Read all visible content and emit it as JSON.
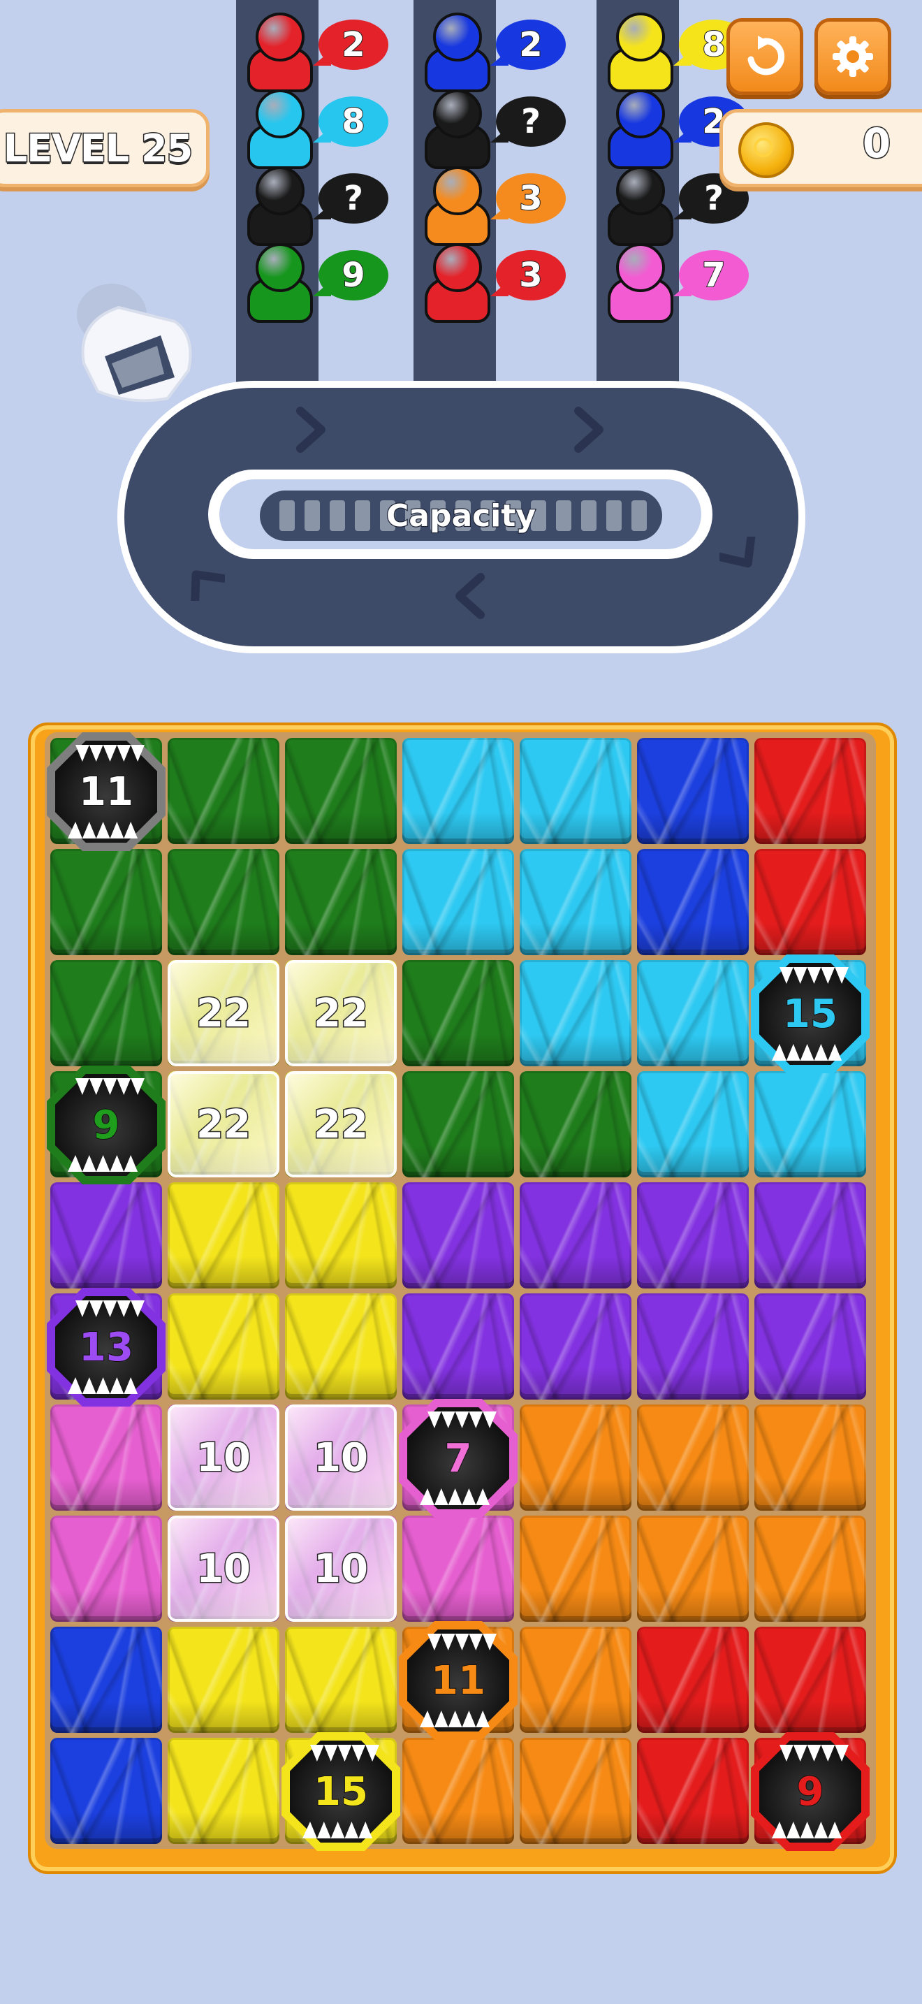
{
  "hud": {
    "level_label": "LEVEL 25",
    "coins": "0",
    "restart_icon": "restart-icon",
    "settings_icon": "gear-icon"
  },
  "queues": [
    {
      "people": [
        {
          "color": "#e4222a",
          "bubble": "2"
        },
        {
          "color": "#27c6ee",
          "bubble": "8"
        },
        {
          "color": "#1a1a1a",
          "bubble": "?"
        },
        {
          "color": "#17961e",
          "bubble": "9"
        }
      ]
    },
    {
      "people": [
        {
          "color": "#1737e0",
          "bubble": "2"
        },
        {
          "color": "#1a1a1a",
          "bubble": "?"
        },
        {
          "color": "#f58b1e",
          "bubble": "3"
        },
        {
          "color": "#e4222a",
          "bubble": "3"
        }
      ]
    },
    {
      "people": [
        {
          "color": "#f6e41b",
          "bubble": "8"
        },
        {
          "color": "#1737e0",
          "bubble": "2"
        },
        {
          "color": "#1a1a1a",
          "bubble": "?"
        },
        {
          "color": "#f35bd3",
          "bubble": "7"
        }
      ]
    }
  ],
  "conveyor": {
    "capacity_label": "Capacity"
  },
  "palette": {
    "G": "#1f7d1c",
    "C": "#2ec9f2",
    "B": "#1c40e0",
    "R": "#e41c1c",
    "P": "#8232e0",
    "Y": "#f4e41c",
    "K": "#e65fd0",
    "O": "#f68a14"
  },
  "board": {
    "rows": [
      [
        "G",
        "G",
        "G",
        "C",
        "C",
        "B",
        "R"
      ],
      [
        "G",
        "G",
        "G",
        "C",
        "C",
        "B",
        "R"
      ],
      [
        "G",
        "Y",
        "Y",
        "G",
        "C",
        "C",
        "C"
      ],
      [
        "G",
        "Y",
        "Y",
        "G",
        "G",
        "C",
        "C"
      ],
      [
        "P",
        "Y",
        "Y",
        "P",
        "P",
        "P",
        "P"
      ],
      [
        "P",
        "Y",
        "Y",
        "P",
        "P",
        "P",
        "P"
      ],
      [
        "K",
        "K",
        "K",
        "K",
        "O",
        "O",
        "O"
      ],
      [
        "K",
        "K",
        "K",
        "K",
        "O",
        "O",
        "O"
      ],
      [
        "B",
        "Y",
        "Y",
        "O",
        "O",
        "R",
        "R"
      ],
      [
        "B",
        "Y",
        "Y",
        "O",
        "O",
        "R",
        "R"
      ]
    ],
    "ice_blocks": [
      {
        "row": 2,
        "col": 1,
        "value": "22"
      },
      {
        "row": 2,
        "col": 2,
        "value": "22"
      },
      {
        "row": 3,
        "col": 1,
        "value": "22"
      },
      {
        "row": 3,
        "col": 2,
        "value": "22"
      },
      {
        "row": 6,
        "col": 1,
        "value": "10"
      },
      {
        "row": 6,
        "col": 2,
        "value": "10"
      },
      {
        "row": 7,
        "col": 1,
        "value": "10"
      },
      {
        "row": 7,
        "col": 2,
        "value": "10"
      }
    ],
    "monsters": [
      {
        "row": 0,
        "col": 0,
        "value": "11",
        "color": "#7e7e7e",
        "text_color": "#ffffff"
      },
      {
        "row": 2,
        "col": 6,
        "value": "15",
        "color": "#2ec9f2",
        "text_color": "#2ec9f2"
      },
      {
        "row": 3,
        "col": 0,
        "value": "9",
        "color": "#1f7d1c",
        "text_color": "#1f9d1c"
      },
      {
        "row": 5,
        "col": 0,
        "value": "13",
        "color": "#8232e0",
        "text_color": "#9c4cf2"
      },
      {
        "row": 6,
        "col": 3,
        "value": "7",
        "color": "#e65fd0",
        "text_color": "#f070d8"
      },
      {
        "row": 8,
        "col": 3,
        "value": "11",
        "color": "#f68a14",
        "text_color": "#f68a14"
      },
      {
        "row": 9,
        "col": 2,
        "value": "15",
        "color": "#f4e41c",
        "text_color": "#f4e41c"
      },
      {
        "row": 9,
        "col": 6,
        "value": "9",
        "color": "#e41c1c",
        "text_color": "#e41c1c"
      }
    ]
  }
}
